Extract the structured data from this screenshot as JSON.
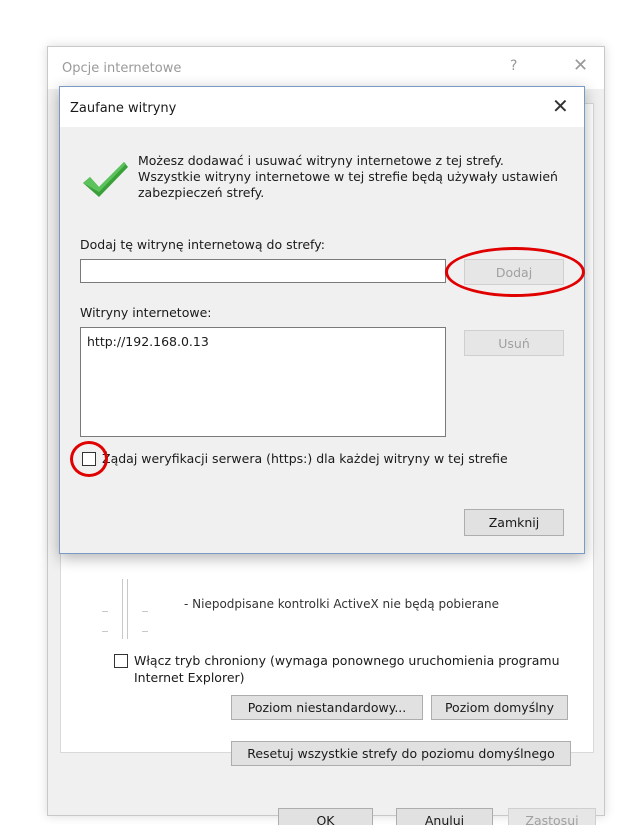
{
  "parent_window": {
    "title": "Opcje internetowe",
    "help_symbol": "?",
    "close_symbol": "✕",
    "activex_text": "- Niepodpisane kontrolki ActiveX nie będą pobierane",
    "protected_mode": {
      "label": "Włącz tryb chroniony (wymaga ponownego uruchomienia programu Internet Explorer)",
      "checked": false
    },
    "buttons": {
      "custom_level": "Poziom niestandardowy...",
      "default_level": "Poziom domyślny",
      "reset_all": "Resetuj wszystkie strefy do poziomu domyślnego",
      "ok": "OK",
      "cancel": "Anuluj",
      "apply": "Zastosuj"
    }
  },
  "dialog": {
    "title": "Zaufane witryny",
    "close_symbol": "✕",
    "info_text": "Możesz dodawać i usuwać witryny internetowe z tej strefy. Wszystkie witryny internetowe w tej strefie będą używały ustawień zabezpieczeń strefy.",
    "add_label": "Dodaj tę witrynę internetową do strefy:",
    "add_input_value": "",
    "add_button": "Dodaj",
    "sites_label": "Witryny internetowe:",
    "sites": [
      "http://192.168.0.13"
    ],
    "remove_button": "Usuń",
    "https_checkbox": {
      "label": "Żądaj weryfikacji serwera (https:) dla każdej witryny w tej strefie",
      "checked": false
    },
    "close_button": "Zamknij"
  },
  "icons": {
    "success": "checkmark-icon"
  },
  "colors": {
    "check_green": "#3aa13a",
    "annotation_red": "#e00000",
    "disabled_text": "#a0a0a0"
  }
}
